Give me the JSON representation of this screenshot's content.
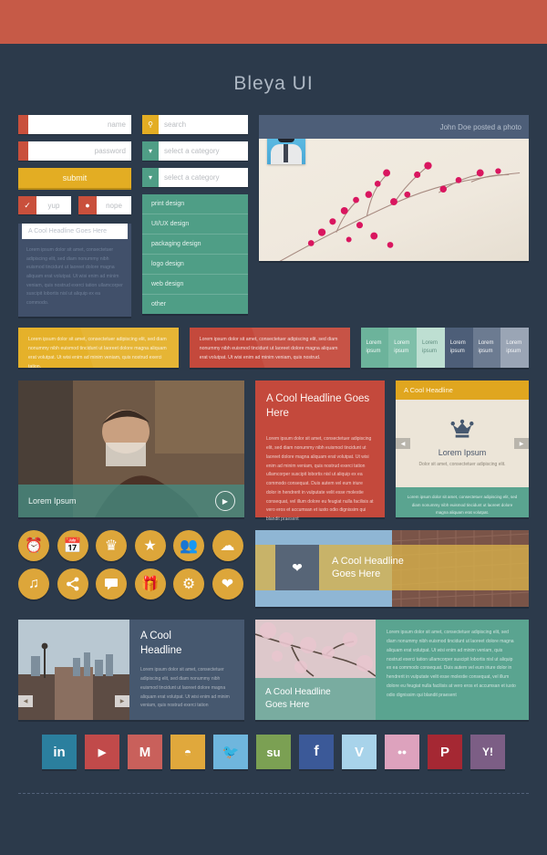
{
  "page": {
    "title": "Bleya UI",
    "accent_red": "#c65a47",
    "bg": "#2c3a4b"
  },
  "form": {
    "name_placeholder": "name",
    "password_placeholder": "password",
    "submit_label": "submit",
    "toggle_yes": "yup",
    "toggle_no": "nope",
    "note_title": "A Cool Headline Goes Here",
    "note_body": "Lorem ipsum dolor sit amet, consectetuer adipiscing elit, sed diam nonummy nibh euismod tincidunt ut laoreet dolore magna aliquam erat volutpat. Ut wisi enim ad minim veniam, quis nostrud exerci tation ullamcorper suscipit lobortis nisl ut aliquip ex ea commodo."
  },
  "selects": {
    "search_placeholder": "search",
    "category_placeholder": "select a category",
    "category_open_placeholder": "select a category",
    "options": [
      "print design",
      "UI/UX design",
      "packaging design",
      "logo design",
      "web design",
      "other"
    ]
  },
  "photo_card": {
    "meta": "John Doe posted a photo"
  },
  "alerts": {
    "yellow": "Lorem ipsum dolor sit amet, consectetuer adipiscing elit, sed diam nonummy nibh euismod tincidunt ut laoreet dolore magna aliquam erat volutpat. Ut wisi enim ad minim veniam, quis nostrud exerci tation.",
    "red": "Lorem ipsum dolor sit amet, consectetuer adipiscing elit, sed diam nonummy nibh euismod tincidunt ut laoreet dolore magna aliquam erat volutpat. Ut wisi enim ad minim veniam, quis nostrud."
  },
  "tabs": [
    {
      "label": "Lorem ipsum",
      "color": "#6cb39b"
    },
    {
      "label": "Lorem ipsum",
      "color": "#7fbfa9"
    },
    {
      "label": "Lorem ipsum",
      "color": "#bedfd2"
    },
    {
      "label": "Lorem ipsum",
      "color": "#4d5e78"
    },
    {
      "label": "Lorem ipsum",
      "color": "#6c7b91"
    },
    {
      "label": "Lorem ipsum",
      "color": "#9aa5b5"
    }
  ],
  "video": {
    "caption": "Lorem Ipsum",
    "play_icon": "play-icon"
  },
  "panel_red": {
    "headline": "A Cool Headline Goes Here",
    "body": "Lorem ipsum dolor sit amet, consectetuer adipiscing elit, sed diam nonummy nibh euismod tincidunt ut laoreet dolore magna aliquam erat volutpat. Ut wisi enim ad minim veniam, quis nostrud exerci tation ullamcorper suscipit lobortis nisl ut aliquip ex ea commodo consequat. Duis autem vel eum iriure dolor in hendrerit in vulputate velit esse molestie consequat, vel illum dolore eu feugiat nulla facilisis at vero eros et accumsan et iusto odio dignissim qui blandit praesent"
  },
  "carousel": {
    "header": "A Cool Headline",
    "icon": "crown-icon",
    "title": "Lorem Ipsum",
    "subtitle": "Dolor sit amet, consectetuer adipiscing elit.",
    "footer": "Lorem ipsum dolor sit amet, consectetuer adipiscing elit, sed diam nonummy nibh euismod tincidunt ut laoreet dolore magna aliquam erat volutpat.",
    "prev": "◀",
    "next": "▶"
  },
  "icon_grid": [
    "alarm-clock-icon",
    "calendar-icon",
    "crown-icon",
    "star-icon",
    "users-icon",
    "cloud-icon",
    "music-note-icon",
    "share-icon",
    "chat-bubble-icon",
    "gift-icon",
    "gear-icon",
    "heart-icon"
  ],
  "banner": {
    "icon": "heart-icon",
    "headline_line1": "A Cool Headline",
    "headline_line2": "Goes Here"
  },
  "slider": {
    "headline_line1": "A Cool",
    "headline_line2": "Headline",
    "body": "Lorem ipsum dolor sit amet, consectetuer adipiscing elit, sed diam nonummy nibh euismod tincidunt ut laoreet dolore magna aliquam erat volutpat. Ut wisi enim ad minim veniam, quis nostrud exerci tation",
    "prev": "◀",
    "next": "▶"
  },
  "blossom": {
    "headline_line1": "A Cool Headline",
    "headline_line2": "Goes Here",
    "body": "Lorem ipsum dolor sit amet, consectetuer adipiscing elit, sed diam nonummy nibh euismod tincidunt ut laoreet dolore magna aliquam erat volutpat. Ut wisi enim ad minim veniam, quis nostrud exerci tation ullamcorper suscipit lobortis nisl ut aliquip ex ea commodo consequat. Duis autem vel eum iriure dolor in hendrerit in vulputate velit esse molestie consequat, vel illum dolore eu feugiat nulla facilisis at vero eros et accumsan et iusto odio dignissim qui blandit praesent"
  },
  "social": [
    {
      "name": "linkedin",
      "glyph": "in",
      "color": "#2b7f9e"
    },
    {
      "name": "youtube",
      "glyph": "▶",
      "color": "#c14a4a"
    },
    {
      "name": "gmail",
      "glyph": "M",
      "color": "#c9605b"
    },
    {
      "name": "rss",
      "glyph": "◔",
      "color": "#e0a83c"
    },
    {
      "name": "twitter",
      "glyph": "ᴠ",
      "color": "#6fb6dd"
    },
    {
      "name": "stumbleupon",
      "glyph": "su",
      "color": "#78a css"
    },
    {
      "name": "facebook",
      "glyph": "f",
      "color": "#3b5998"
    },
    {
      "name": "vimeo",
      "glyph": "V",
      "color": "#a8d3ea"
    },
    {
      "name": "flickr",
      "glyph": "••",
      "color": "#dda2bd"
    },
    {
      "name": "pinterest",
      "glyph": "P",
      "color": "#a52833"
    },
    {
      "name": "yahoo",
      "glyph": "Y!",
      "color": "#7c5e85"
    }
  ]
}
